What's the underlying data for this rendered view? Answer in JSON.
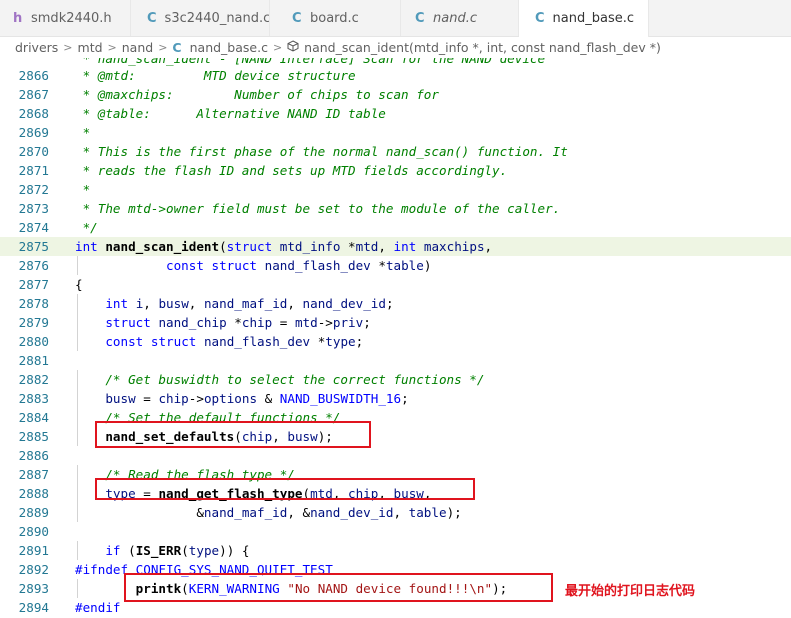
{
  "tabs": [
    {
      "icon": "h",
      "label": "smdk2440.h",
      "italic": false,
      "active": false
    },
    {
      "icon": "C",
      "label": "s3c2440_nand.c",
      "italic": false,
      "active": false
    },
    {
      "icon": "C",
      "label": "board.c",
      "italic": false,
      "active": false
    },
    {
      "icon": "C",
      "label": "nand.c",
      "italic": true,
      "active": false
    },
    {
      "icon": "C",
      "label": "nand_base.c",
      "italic": false,
      "active": true
    }
  ],
  "tab_close": "✕",
  "breadcrumb": {
    "seg1": "drivers",
    "seg2": "mtd",
    "seg3": "nand",
    "file_icon": "C",
    "file": "nand_base.c",
    "symbol": "nand_scan_ident(mtd_info *, int, const nand_flash_dev *)"
  },
  "editor": {
    "cut_line": " * nand_scan_ident - [NAND Interface] Scan for the NAND device",
    "lines": [
      {
        "n": "2866",
        "text": " * @mtd:         MTD device structure"
      },
      {
        "n": "2867",
        "text": " * @maxchips:        Number of chips to scan for"
      },
      {
        "n": "2868",
        "text": " * @table:      Alternative NAND ID table"
      },
      {
        "n": "2869",
        "text": " *"
      },
      {
        "n": "2870",
        "text": " * This is the first phase of the normal nand_scan() function. It"
      },
      {
        "n": "2871",
        "text": " * reads the flash ID and sets up MTD fields accordingly."
      },
      {
        "n": "2872",
        "text": " *"
      },
      {
        "n": "2873",
        "text": " * The mtd->owner field must be set to the module of the caller."
      },
      {
        "n": "2874",
        "text": " */"
      },
      {
        "n": "2875",
        "text": "int nand_scan_ident(struct mtd_info *mtd, int maxchips,"
      },
      {
        "n": "2876",
        "text": "            const struct nand_flash_dev *table)"
      },
      {
        "n": "2877",
        "text": "{"
      },
      {
        "n": "2878",
        "text": "    int i, busw, nand_maf_id, nand_dev_id;"
      },
      {
        "n": "2879",
        "text": "    struct nand_chip *chip = mtd->priv;"
      },
      {
        "n": "2880",
        "text": "    const struct nand_flash_dev *type;"
      },
      {
        "n": "2881",
        "text": ""
      },
      {
        "n": "2882",
        "text": "    /* Get buswidth to select the correct functions */"
      },
      {
        "n": "2883",
        "text": "    busw = chip->options & NAND_BUSWIDTH_16;"
      },
      {
        "n": "2884",
        "text": "    /* Set the default functions */"
      },
      {
        "n": "2885",
        "text": "    nand_set_defaults(chip, busw);"
      },
      {
        "n": "2886",
        "text": ""
      },
      {
        "n": "2887",
        "text": "    /* Read the flash type */"
      },
      {
        "n": "2888",
        "text": "    type = nand_get_flash_type(mtd, chip, busw,"
      },
      {
        "n": "2889",
        "text": "                &nand_maf_id, &nand_dev_id, table);"
      },
      {
        "n": "2890",
        "text": ""
      },
      {
        "n": "2891",
        "text": "    if (IS_ERR(type)) {"
      },
      {
        "n": "2892",
        "text": "#ifndef CONFIG_SYS_NAND_QUIET_TEST"
      },
      {
        "n": "2893",
        "text": "        printk(KERN_WARNING \"No NAND device found!!!\\n\");"
      },
      {
        "n": "2894",
        "text": "#endif"
      }
    ]
  },
  "annotation": "最开始的打印日志代码",
  "colors": {
    "highlight_box": "#e0141e",
    "current_line": "#eef5e3",
    "line_number": "#237893",
    "comment": "#008000",
    "keyword": "#0000ff"
  }
}
